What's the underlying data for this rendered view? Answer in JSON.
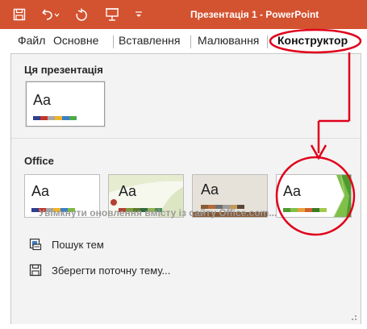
{
  "window": {
    "title": "Презентація 1  -  PowerPoint",
    "accent": "#d35230",
    "quick_access": [
      "save-icon",
      "undo-icon",
      "redo-icon",
      "present-icon",
      "customize-icon"
    ]
  },
  "tabs": [
    {
      "label": "Файл"
    },
    {
      "label": "Основне"
    },
    {
      "label": "Вставлення"
    },
    {
      "label": "Малювання"
    },
    {
      "label": "Конструктор",
      "active": true
    }
  ],
  "themes_panel": {
    "this_presentation": {
      "title": "Ця презентація",
      "thumb_label": "Aa"
    },
    "office": {
      "title": "Office",
      "thumbs": [
        {
          "label": "Aa"
        },
        {
          "label": "Aa"
        },
        {
          "label": "Aa"
        },
        {
          "label": "Aa"
        }
      ]
    },
    "office_link": "Увімкнути оновлення вмісту із сайту Office.com...",
    "browse": "Пошук тем",
    "save": "Зберегти поточну тему..."
  },
  "annotation_color": "#e0001b"
}
